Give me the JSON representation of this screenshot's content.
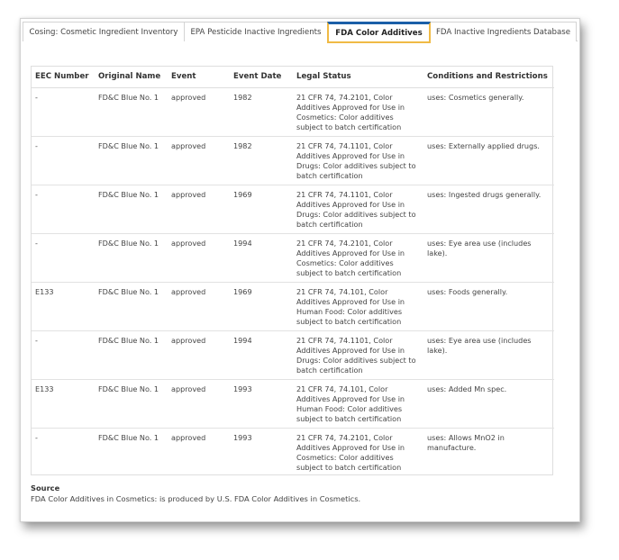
{
  "tabs": [
    {
      "label": "Cosing: Cosmetic Ingredient Inventory",
      "active": false
    },
    {
      "label": "EPA Pesticide Inactive Ingredients",
      "active": false
    },
    {
      "label": "FDA Color Additives",
      "active": true
    },
    {
      "label": "FDA Inactive Ingredients Database",
      "active": false
    }
  ],
  "table": {
    "headers": [
      "EEC Number",
      "Original Name",
      "Event",
      "Event Date",
      "Legal Status",
      "Conditions and Restrictions"
    ],
    "rows": [
      [
        "-",
        "FD&C Blue No. 1",
        "approved",
        "1982",
        "21 CFR 74, 74.2101, Color Additives Approved for Use in Cosmetics: Color additives subject to batch certification",
        "uses: Cosmetics generally."
      ],
      [
        "-",
        "FD&C Blue No. 1",
        "approved",
        "1982",
        "21 CFR 74, 74.1101, Color Additives Approved for Use in Drugs: Color additives subject to batch certification",
        "uses: Externally applied drugs."
      ],
      [
        "-",
        "FD&C Blue No. 1",
        "approved",
        "1969",
        "21 CFR 74, 74.1101, Color Additives Approved for Use in Drugs: Color additives subject to batch certification",
        "uses: Ingested drugs generally."
      ],
      [
        "-",
        "FD&C Blue No. 1",
        "approved",
        "1994",
        "21 CFR 74, 74.2101, Color Additives Approved for Use in Cosmetics: Color additives subject to batch certification",
        "uses: Eye area use (includes lake)."
      ],
      [
        "E133",
        "FD&C Blue No. 1",
        "approved",
        "1969",
        "21 CFR 74, 74.101, Color Additives Approved for Use in Human Food: Color additives subject to batch certification",
        "uses: Foods generally."
      ],
      [
        "-",
        "FD&C Blue No. 1",
        "approved",
        "1994",
        "21 CFR 74, 74.1101, Color Additives Approved for Use in Drugs: Color additives subject to batch certification",
        "uses: Eye area use (includes lake)."
      ],
      [
        "E133",
        "FD&C Blue No. 1",
        "approved",
        "1993",
        "21 CFR 74, 74.101, Color Additives Approved for Use in Human Food: Color additives subject to batch certification",
        "uses: Added Mn spec."
      ],
      [
        "-",
        "FD&C Blue No. 1",
        "approved",
        "1993",
        "21 CFR 74, 74.2101, Color Additives Approved for Use in Cosmetics: Color additives subject to batch certification",
        "uses: Allows MnO2 in manufacture."
      ]
    ]
  },
  "source": {
    "label": "Source",
    "text": "FDA Color Additives in Cosmetics: is produced by U.S. FDA Color Additives in Cosmetics."
  },
  "colors": {
    "active_tab_top": "#1b5fa8",
    "active_tab_border": "#f0ba45"
  }
}
